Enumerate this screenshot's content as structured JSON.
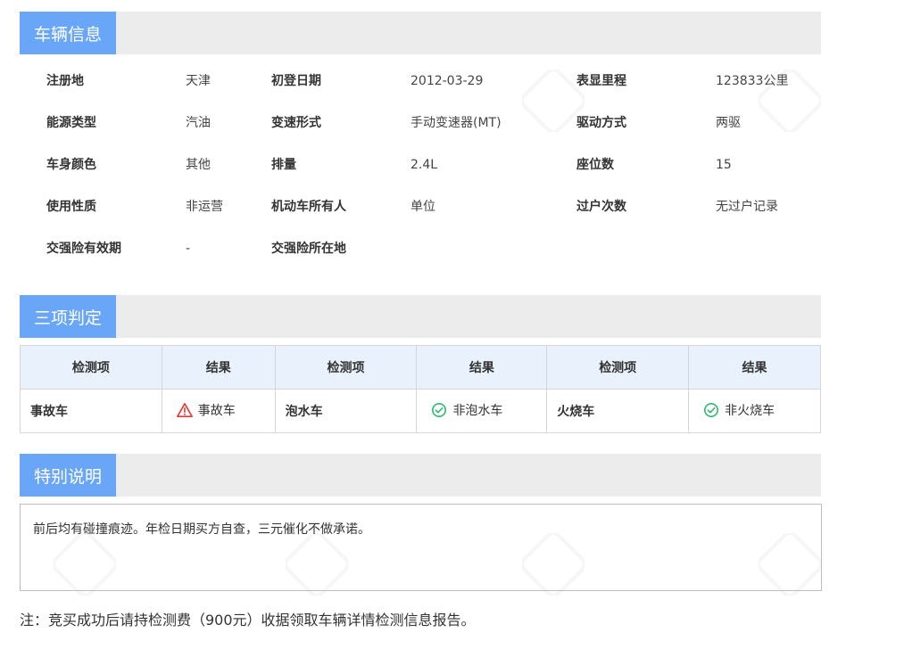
{
  "sections": {
    "vehicle_info": "车辆信息",
    "three_checks": "三项判定",
    "special_notes": "特别说明"
  },
  "vehicle_info": {
    "rows": [
      [
        {
          "label": "注册地",
          "value": "天津"
        },
        {
          "label": "初登日期",
          "value": "2012-03-29"
        },
        {
          "label": "表显里程",
          "value": "123833公里"
        }
      ],
      [
        {
          "label": "能源类型",
          "value": "汽油"
        },
        {
          "label": "变速形式",
          "value": "手动变速器(MT)"
        },
        {
          "label": "驱动方式",
          "value": "两驱"
        }
      ],
      [
        {
          "label": "车身颜色",
          "value": "其他"
        },
        {
          "label": "排量",
          "value": "2.4L"
        },
        {
          "label": "座位数",
          "value": "15"
        }
      ],
      [
        {
          "label": "使用性质",
          "value": "非运营"
        },
        {
          "label": "机动车所有人",
          "value": "单位"
        },
        {
          "label": "过户次数",
          "value": "无过户记录"
        }
      ],
      [
        {
          "label": "交强险有效期",
          "value": "-"
        },
        {
          "label": "交强险所在地",
          "value": ""
        }
      ]
    ]
  },
  "three_checks": {
    "headers": [
      "检测项",
      "结果",
      "检测项",
      "结果",
      "检测项",
      "结果"
    ],
    "items": [
      {
        "item": "事故车",
        "result": "事故车",
        "status": "warning",
        "color": "#e53935"
      },
      {
        "item": "泡水车",
        "result": "非泡水车",
        "status": "ok",
        "color": "#2eb872"
      },
      {
        "item": "火烧车",
        "result": "非火烧车",
        "status": "ok",
        "color": "#2eb872"
      }
    ]
  },
  "special_notes": {
    "text": "前后均有碰撞痕迹。年检日期买方自查，三元催化不做承诺。"
  },
  "footer": "注：竞买成功后请持检测费（900元）收据领取车辆详情检测信息报告。",
  "colors": {
    "tab_blue": "#6aa6f8",
    "header_gray": "#ececec",
    "table_header_bg": "#e8f1fc"
  }
}
